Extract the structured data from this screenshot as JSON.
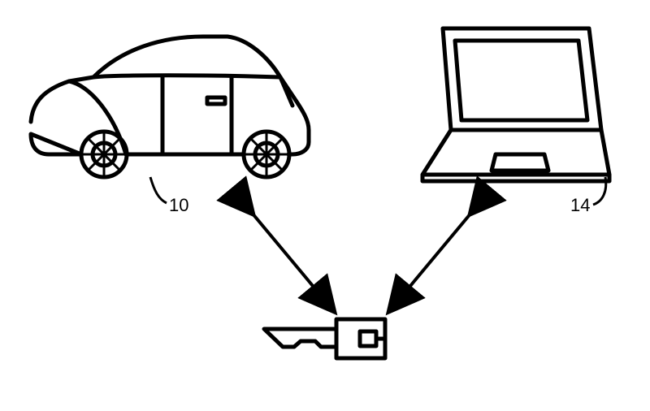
{
  "labels": {
    "vehicle": "10",
    "laptop": "14"
  }
}
